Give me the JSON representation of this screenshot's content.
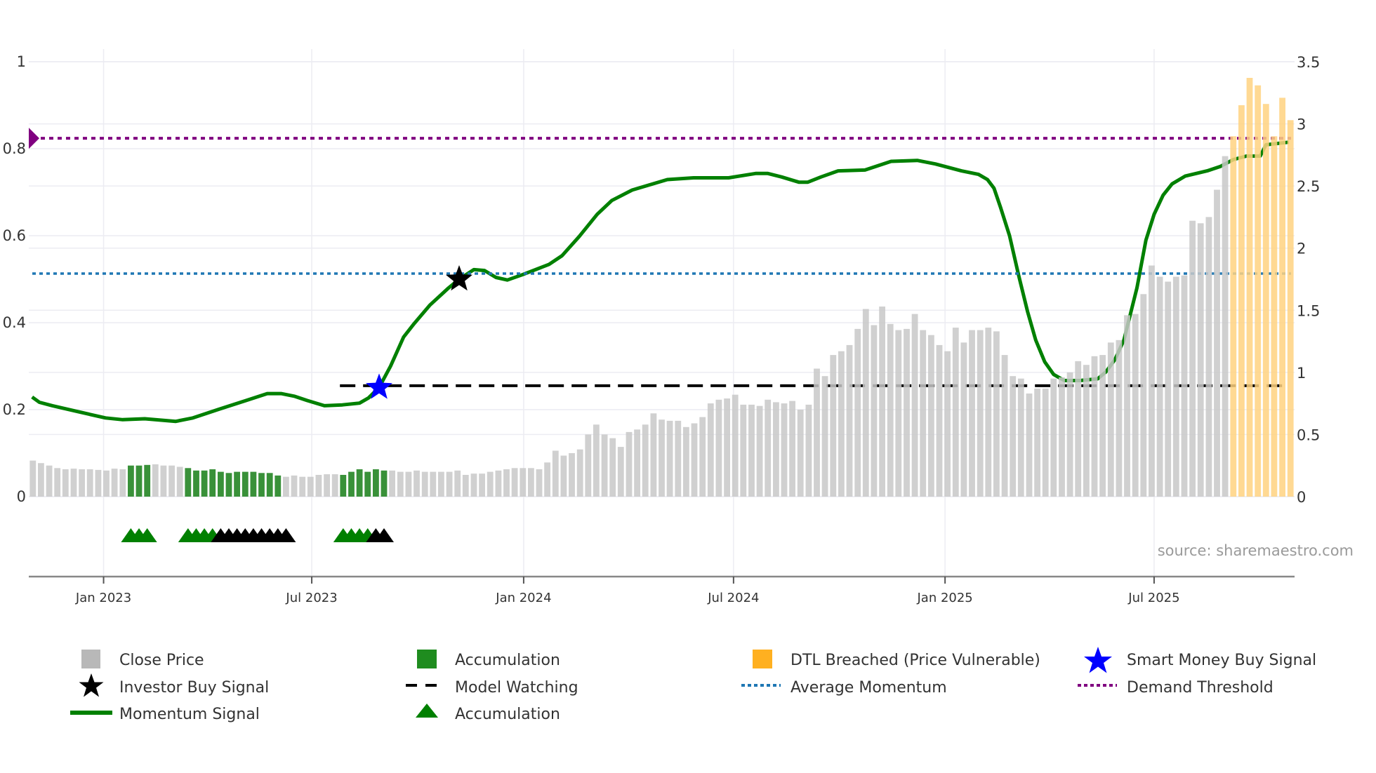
{
  "chart_data": {
    "type": "bar",
    "title": "",
    "x_unit": "week index",
    "left_axis": {
      "ylim": [
        0,
        1
      ],
      "ticks": [
        "0",
        "0.2",
        "0.4",
        "0.6",
        "0.8",
        "1"
      ],
      "tick_values": [
        0,
        0.2,
        0.4,
        0.6,
        0.8,
        1
      ]
    },
    "right_axis": {
      "ylim": [
        0,
        3.5
      ],
      "ticks": [
        "0",
        "0.5",
        "1",
        "1.5",
        "2",
        "2.5",
        "3",
        "3.5"
      ],
      "tick_values": [
        0,
        0.5,
        1,
        1.5,
        2,
        2.5,
        3,
        3.5
      ]
    },
    "x_ticks": [
      {
        "label": "Jan 2023",
        "week": 9.16
      },
      {
        "label": "Jul 2023",
        "week": 34.65
      },
      {
        "label": "Jan 2024",
        "week": 60.6
      },
      {
        "label": "Jul 2024",
        "week": 86.3
      },
      {
        "label": "Jan 2025",
        "week": 112.2
      },
      {
        "label": "Jul 2025",
        "week": 137.8
      }
    ],
    "close_price": [
      0.29,
      0.27,
      0.25,
      0.23,
      0.22,
      0.225,
      0.22,
      0.22,
      0.215,
      0.21,
      0.225,
      0.22,
      0.25,
      0.25,
      0.255,
      0.26,
      0.25,
      0.25,
      0.24,
      0.23,
      0.21,
      0.21,
      0.22,
      0.2,
      0.19,
      0.2,
      0.2,
      0.2,
      0.19,
      0.19,
      0.17,
      0.16,
      0.17,
      0.16,
      0.16,
      0.175,
      0.18,
      0.18,
      0.175,
      0.2,
      0.22,
      0.2,
      0.22,
      0.21,
      0.21,
      0.2,
      0.2,
      0.21,
      0.2,
      0.2,
      0.2,
      0.2,
      0.21,
      0.175,
      0.185,
      0.185,
      0.2,
      0.21,
      0.22,
      0.23,
      0.23,
      0.23,
      0.22,
      0.275,
      0.37,
      0.33,
      0.35,
      0.38,
      0.5,
      0.58,
      0.5,
      0.47,
      0.4,
      0.52,
      0.54,
      0.58,
      0.67,
      0.62,
      0.61,
      0.61,
      0.56,
      0.59,
      0.64,
      0.75,
      0.78,
      0.79,
      0.82,
      0.74,
      0.74,
      0.73,
      0.78,
      0.76,
      0.75,
      0.77,
      0.7,
      0.74,
      1.03,
      0.97,
      1.14,
      1.17,
      1.22,
      1.35,
      1.51,
      1.38,
      1.53,
      1.39,
      1.34,
      1.35,
      1.47,
      1.34,
      1.3,
      1.22,
      1.17,
      1.36,
      1.24,
      1.34,
      1.34,
      1.36,
      1.33,
      1.14,
      0.97,
      0.95,
      0.83,
      0.87,
      0.87,
      0.95,
      0.96,
      1.0,
      1.09,
      1.06,
      1.13,
      1.14,
      1.24,
      1.26,
      1.46,
      1.47,
      1.63,
      1.86,
      1.77,
      1.73,
      1.77,
      1.78,
      2.22,
      2.2,
      2.25,
      2.47,
      2.74,
      2.9,
      3.15,
      3.37,
      3.31,
      3.16,
      2.9,
      3.21,
      3.03
    ],
    "bar_state_ranges": [
      {
        "state": "accumulation",
        "from": 12,
        "to": 14
      },
      {
        "state": "accumulation",
        "from": 19,
        "to": 30
      },
      {
        "state": "accumulation",
        "from": 38,
        "to": 43
      },
      {
        "state": "dtl_breached",
        "from": 147,
        "to": 154
      }
    ],
    "momentum_signal": [
      [
        0.4,
        0.229
      ],
      [
        1.3,
        0.217
      ],
      [
        2.9,
        0.209
      ],
      [
        6.1,
        0.195
      ],
      [
        9.4,
        0.181
      ],
      [
        11.5,
        0.177
      ],
      [
        14.2,
        0.179
      ],
      [
        18,
        0.173
      ],
      [
        20.1,
        0.181
      ],
      [
        23.3,
        0.201
      ],
      [
        26.6,
        0.221
      ],
      [
        29.2,
        0.237
      ],
      [
        30.9,
        0.237
      ],
      [
        32.5,
        0.231
      ],
      [
        34.1,
        0.221
      ],
      [
        36.2,
        0.209
      ],
      [
        38.4,
        0.211
      ],
      [
        40.5,
        0.215
      ],
      [
        41.6,
        0.227
      ],
      [
        42.9,
        0.251
      ],
      [
        44.3,
        0.3
      ],
      [
        45.9,
        0.367
      ],
      [
        47.2,
        0.398
      ],
      [
        49.1,
        0.44
      ],
      [
        51.3,
        0.478
      ],
      [
        52.7,
        0.5
      ],
      [
        54.5,
        0.522
      ],
      [
        55.8,
        0.52
      ],
      [
        57.2,
        0.504
      ],
      [
        58.6,
        0.498
      ],
      [
        60.4,
        0.51
      ],
      [
        63.7,
        0.534
      ],
      [
        65.3,
        0.554
      ],
      [
        67.4,
        0.598
      ],
      [
        69.6,
        0.649
      ],
      [
        71.4,
        0.681
      ],
      [
        73.9,
        0.705
      ],
      [
        78.2,
        0.729
      ],
      [
        81.4,
        0.733
      ],
      [
        85.7,
        0.733
      ],
      [
        89,
        0.743
      ],
      [
        90.5,
        0.743
      ],
      [
        92.2,
        0.735
      ],
      [
        94.3,
        0.723
      ],
      [
        95.4,
        0.723
      ],
      [
        97,
        0.735
      ],
      [
        99.1,
        0.749
      ],
      [
        102.4,
        0.751
      ],
      [
        105.6,
        0.771
      ],
      [
        108.8,
        0.773
      ],
      [
        111,
        0.765
      ],
      [
        114.2,
        0.749
      ],
      [
        116.3,
        0.741
      ],
      [
        117.4,
        0.729
      ],
      [
        118.2,
        0.709
      ],
      [
        119,
        0.665
      ],
      [
        120.1,
        0.6
      ],
      [
        121.2,
        0.51
      ],
      [
        122.3,
        0.426
      ],
      [
        123.3,
        0.36
      ],
      [
        124.4,
        0.31
      ],
      [
        125.5,
        0.281
      ],
      [
        126.8,
        0.267
      ],
      [
        128.7,
        0.267
      ],
      [
        130.9,
        0.271
      ],
      [
        131.9,
        0.287
      ],
      [
        133,
        0.315
      ],
      [
        134.1,
        0.36
      ],
      [
        135.7,
        0.48
      ],
      [
        136.8,
        0.59
      ],
      [
        137.8,
        0.649
      ],
      [
        138.9,
        0.693
      ],
      [
        140,
        0.719
      ],
      [
        141.6,
        0.737
      ],
      [
        144.3,
        0.749
      ],
      [
        145.9,
        0.759
      ],
      [
        147.5,
        0.775
      ],
      [
        149.1,
        0.783
      ],
      [
        150.8,
        0.783
      ],
      [
        151.5,
        0.809
      ],
      [
        154.3,
        0.815
      ]
    ],
    "average_momentum": 0.513,
    "demand_threshold": 0.824,
    "model_watching": {
      "value": 0.255,
      "from": 38.1,
      "to": 154.3
    },
    "smart_money_buy_signal": {
      "week": 42.9,
      "value": 0.251
    },
    "investor_buy_signal": {
      "week": 52.7,
      "value": 0.5
    },
    "accumulation_markers": [
      12,
      13,
      14,
      19,
      20,
      21,
      22,
      38,
      39,
      40,
      41
    ],
    "investor_markers": [
      23,
      24,
      25,
      26,
      27,
      28,
      29,
      30,
      31,
      42,
      43
    ],
    "colors": {
      "close_price": "#c8c8c8",
      "accumulation": "#2e8b2e",
      "dtl_breached": "#ffd280",
      "momentum": "#008000",
      "average_momentum": "#1f77b4",
      "demand_threshold": "#800080",
      "smart_money": "#0000ff",
      "investor": "#000000"
    },
    "legend_position": "bottom",
    "source": "source: sharemaestro.com"
  },
  "legend": {
    "close_price": "Close Price",
    "accumulation_bar": "Accumulation",
    "dtl_breached": "DTL Breached (Price Vulnerable)",
    "smart_money": "Smart Money Buy Signal",
    "investor_buy": "Investor Buy Signal",
    "model_watching": "Model Watching",
    "average_momentum": "Average Momentum",
    "demand_threshold": "Demand Threshold",
    "momentum_signal": "Momentum Signal",
    "accumulation_marker": "Accumulation"
  }
}
